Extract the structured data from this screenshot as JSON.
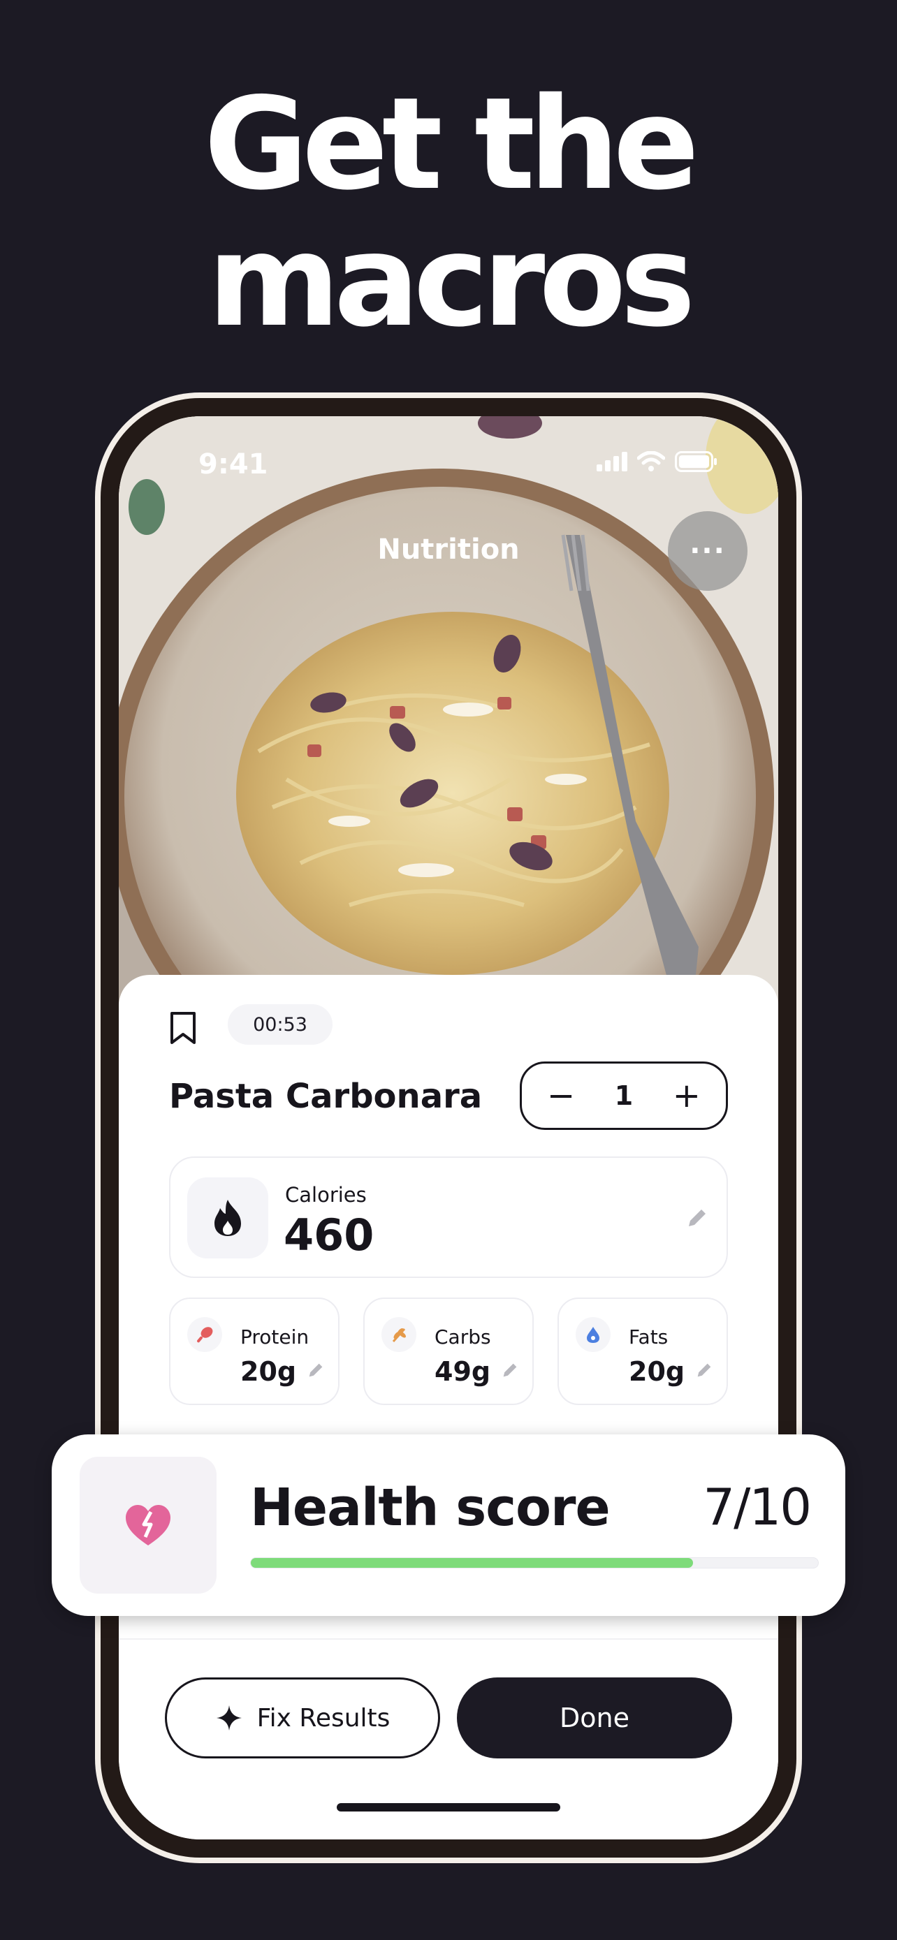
{
  "headline": {
    "line1": "Get the",
    "line2": "macros"
  },
  "status_bar": {
    "time": "9:41"
  },
  "nav": {
    "title": "Nutrition",
    "more_label": "···"
  },
  "meal": {
    "timer": "00:53",
    "name": "Pasta Carbonara",
    "quantity": "1",
    "minus_label": "−",
    "plus_label": "+"
  },
  "calories": {
    "label": "Calories",
    "value": "460"
  },
  "macros": [
    {
      "label": "Protein",
      "value": "20g",
      "icon": "drumstick-icon",
      "color": "#e35d5d"
    },
    {
      "label": "Carbs",
      "value": "49g",
      "icon": "wheat-icon",
      "color": "#e59a4a"
    },
    {
      "label": "Fats",
      "value": "20g",
      "icon": "oil-drop-icon",
      "color": "#4c7fe0"
    }
  ],
  "health": {
    "title": "Health score",
    "score": "7/10",
    "fraction": 0.78,
    "bar_color": "#7edb7a",
    "icon_color": "#e3659a"
  },
  "actions": {
    "fix_label": "Fix Results",
    "done_label": "Done"
  }
}
